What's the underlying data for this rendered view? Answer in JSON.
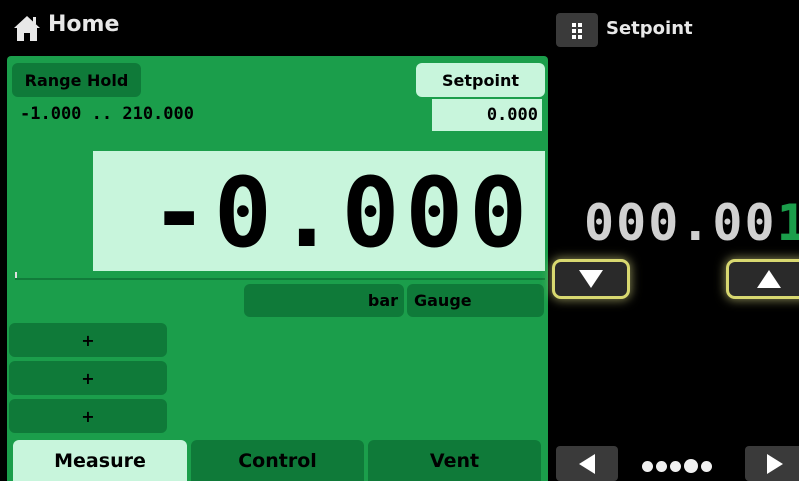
{
  "header": {
    "title": "Home",
    "icon": "home-icon"
  },
  "setpoint_panel": {
    "title": "Setpoint",
    "menu_icon": "grid-menu-icon",
    "digits_inactive": "000.00",
    "digit_active": "1",
    "decrement_icon": "triangle-down-icon",
    "increment_icon": "triangle-up-icon",
    "nav_prev_icon": "triangle-left-icon",
    "nav_next_icon": "triangle-right-icon",
    "page_dots": 5,
    "active_page": 5
  },
  "channel": {
    "range_hold_label": "Range Hold",
    "setpoint_label": "Setpoint",
    "range_text": "-1.000 .. 210.000",
    "setpoint_value": "0.000",
    "reading": "-0.000",
    "unit": "bar",
    "mode": "Gauge",
    "plus_buttons": [
      "+",
      "+",
      "+"
    ]
  },
  "tabs": {
    "measure": "Measure",
    "control": "Control",
    "vent": "Vent",
    "active": "Measure"
  },
  "colors": {
    "panel_green": "#1b9e4b",
    "dark_green": "#0f7a39",
    "light_green": "#c8f5dc",
    "highlight_glow": "#d8d870",
    "background": "#000000"
  }
}
